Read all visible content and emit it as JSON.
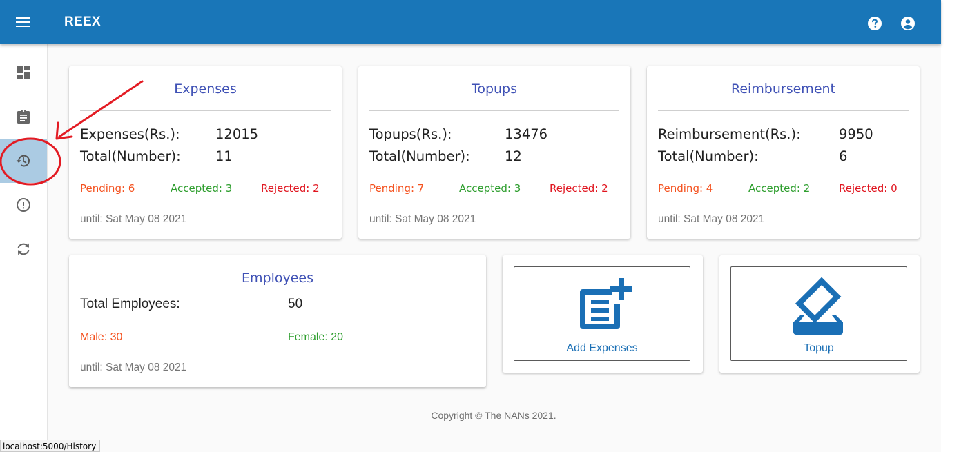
{
  "app": {
    "title": "REEX"
  },
  "header": {
    "menu_icon": "menu-icon",
    "help_icon": "help-icon",
    "account_icon": "account-circle-icon",
    "color": "#1976b8"
  },
  "sidebar": {
    "items": [
      {
        "icon": "dashboard-icon",
        "active": false
      },
      {
        "icon": "clipboard-icon",
        "active": false
      },
      {
        "icon": "history-icon",
        "active": true
      },
      {
        "icon": "alert-circle-icon",
        "active": false
      },
      {
        "icon": "sync-icon",
        "active": false
      }
    ]
  },
  "cards": {
    "expenses": {
      "title": "Expenses",
      "amount_label": "Expenses(Rs.):",
      "amount_value": "12015",
      "total_label": "Total(Number):",
      "total_value": "11",
      "pending": "Pending: 6",
      "accepted": "Accepted: 3",
      "rejected": "Rejected: 2",
      "until": "until: Sat May 08 2021"
    },
    "topups": {
      "title": "Topups",
      "amount_label": "Topups(Rs.):",
      "amount_value": "13476",
      "total_label": "Total(Number):",
      "total_value": "12",
      "pending": "Pending: 7",
      "accepted": "Accepted: 3",
      "rejected": "Rejected: 2",
      "until": "until: Sat May 08 2021"
    },
    "reimbursement": {
      "title": "Reimbursement",
      "amount_label": "Reimbursement(Rs.):",
      "amount_value": "9950",
      "total_label": "Total(Number):",
      "total_value": "6",
      "pending": "Pending: 4",
      "accepted": "Accepted: 2",
      "rejected": "Rejected: 0",
      "until": "until: Sat May 08 2021"
    },
    "employees": {
      "title": "Employees",
      "total_label": "Total Employees:",
      "total_value": "50",
      "male": "Male: 30",
      "female": "Female: 20",
      "until": "until: Sat May 08 2021"
    }
  },
  "actions": {
    "add_expenses": {
      "label": "Add Expenses",
      "icon": "post-add-icon"
    },
    "topup": {
      "label": "Topup",
      "icon": "how-to-vote-icon"
    }
  },
  "footer": {
    "copyright": "Copyright © The NANs 2021."
  },
  "status_bar": {
    "url": "localhost:5000/History"
  },
  "colors": {
    "title": "#3f51b5",
    "pending": "#f4511e",
    "accepted": "#2e9e2e",
    "rejected": "#e0141e",
    "active_nav": "#abcbe3",
    "annotation": "#e31b23"
  }
}
